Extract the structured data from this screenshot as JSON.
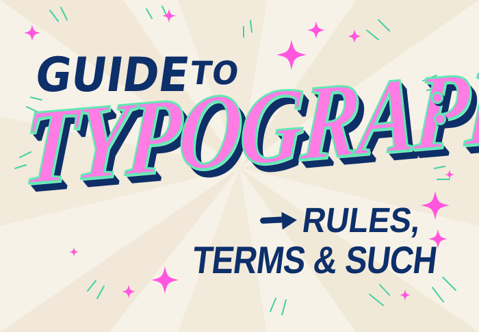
{
  "illustration": {
    "line1": {
      "guide": "GUIDE",
      "to": "TO"
    },
    "main": "TYPOGRAPHY",
    "subtitle": {
      "first": "RULES,",
      "second": "TERMS & SUCH"
    }
  },
  "colors": {
    "background": "#f7f2e7",
    "navy": "#0d2f6a",
    "pink": "#ff7ce5",
    "mint": "#61e8b3"
  },
  "icons": {
    "arrow": "right-arrow-icon",
    "sparkles": "sparkle-icon"
  }
}
